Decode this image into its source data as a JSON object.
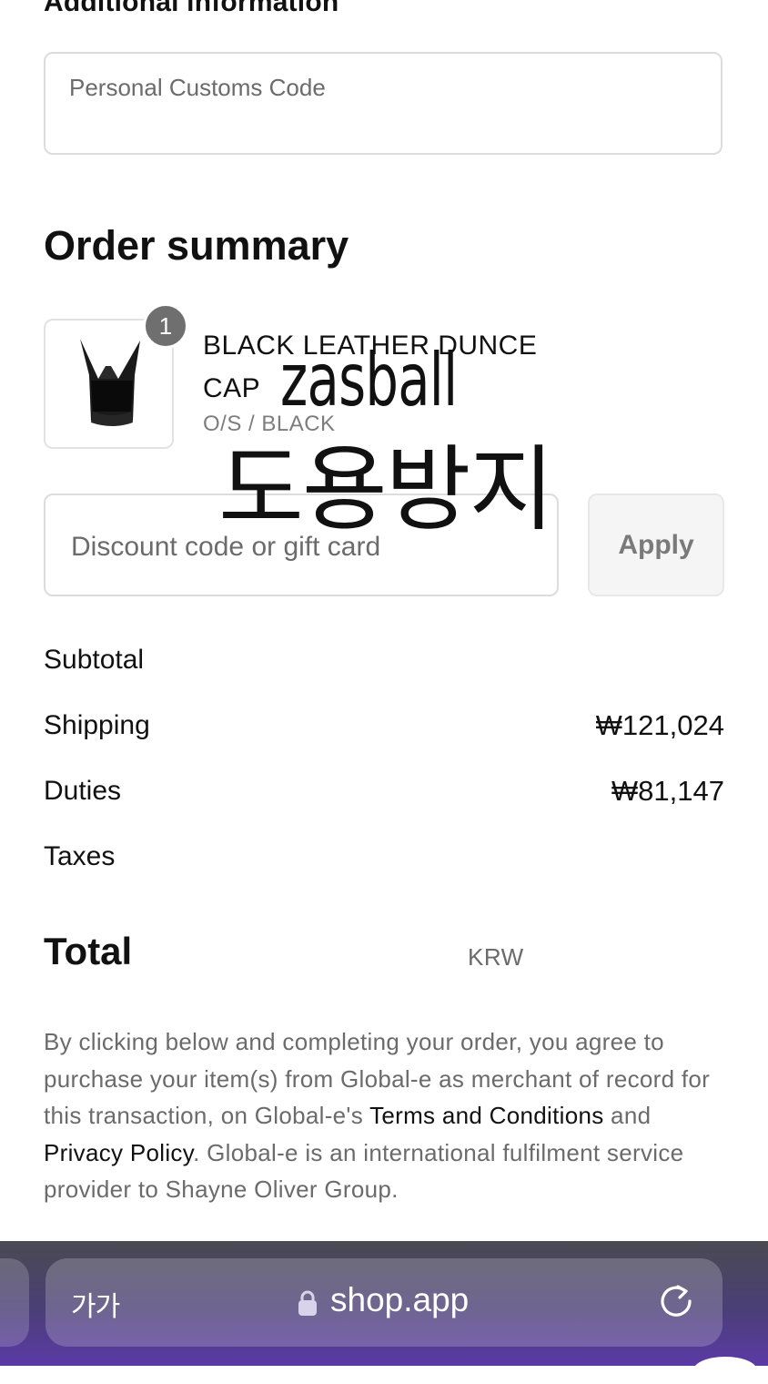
{
  "additional_info": {
    "title": "Additional information",
    "customs_code_placeholder": "Personal Customs Code"
  },
  "order_summary": {
    "title": "Order summary",
    "product": {
      "quantity": "1",
      "name": "BLACK LEATHER DUNCE CAP",
      "variant": "O/S / BLACK"
    },
    "watermark": {
      "line1": "zasball",
      "line2": "도용방지"
    },
    "discount": {
      "placeholder": "Discount code or gift card",
      "apply_label": "Apply"
    },
    "lines": {
      "subtotal_label": "Subtotal",
      "shipping_label": "Shipping",
      "shipping_value": "₩121,024",
      "duties_label": "Duties",
      "duties_value": "₩81,147",
      "taxes_label": "Taxes"
    },
    "total": {
      "label": "Total",
      "currency": "KRW"
    },
    "legal": {
      "part1": "By clicking below and completing your order, you agree to purchase your item(s) from Global-e as merchant of record for this transaction, on Global-e's ",
      "terms_link": "Terms and Conditions",
      "and": " and ",
      "privacy_link": "Privacy Policy",
      "part2": ". Global-e is an international fulfilment service provider to Shayne Oliver Group."
    }
  },
  "browser": {
    "text_size_label": "가가",
    "url": "shop.app",
    "colors": {
      "bar_top": "#4a4a52",
      "bar_bottom": "#5b3aa6"
    }
  }
}
